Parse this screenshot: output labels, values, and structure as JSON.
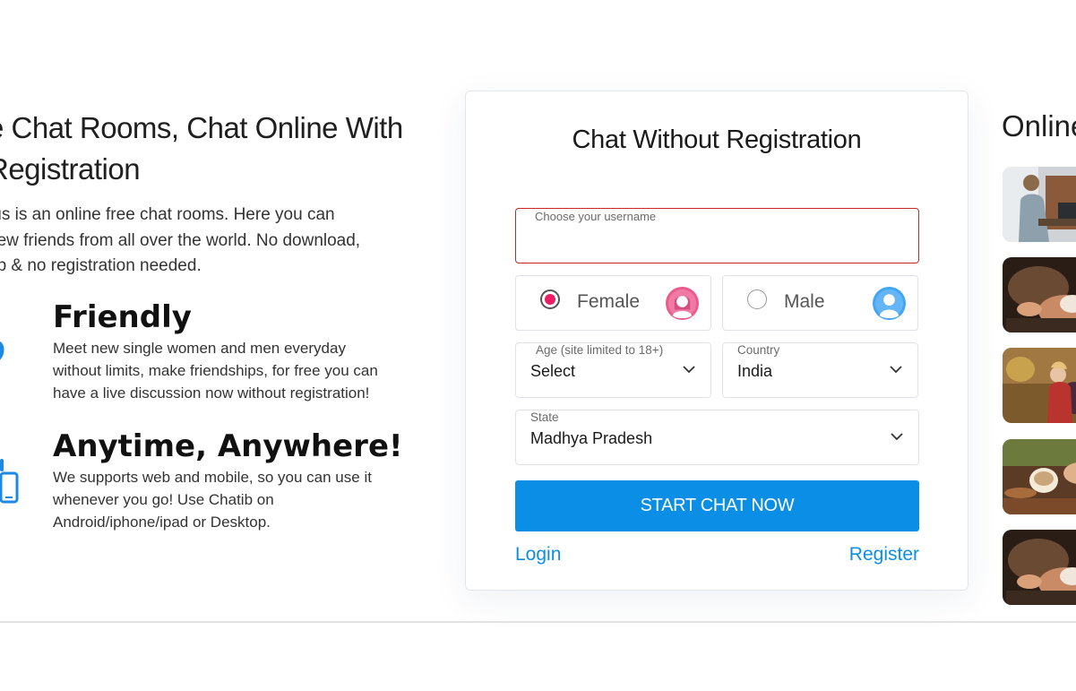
{
  "intro": {
    "title_line1": "e Chat Rooms, Chat Online With",
    "title_line2": "Registration",
    "desc_line1": ".us is an online free chat rooms. Here you can",
    "desc_line2": "new friends from all over the world. No download,",
    "desc_line3": "up & no registration needed."
  },
  "features": [
    {
      "title": "Friendly",
      "icon": "heart-icon",
      "desc_line1": "Meet new single women and men everyday",
      "desc_line2": "without limits, make friendships, for free you can",
      "desc_line3": "have a live discussion now without registration!"
    },
    {
      "title": "Anytime, Anywhere!",
      "icon": "phone-icon",
      "desc_line1": "We supports web and mobile, so you can use it",
      "desc_line2": "whenever you go! Use Chatib on",
      "desc_line3": "Android/iphone/ipad or Desktop."
    }
  ],
  "form": {
    "title": "Chat Without Registration",
    "username": {
      "label": "Choose your username",
      "value": ""
    },
    "gender": {
      "female_label": "Female",
      "male_label": "Male",
      "selected": "female"
    },
    "age": {
      "label": "Age (site limited to 18+)",
      "value": "Select"
    },
    "country": {
      "label": "Country",
      "value": "India"
    },
    "state": {
      "label": "State",
      "value": "Madhya Pradesh"
    },
    "start_button": "START CHAT NOW",
    "login_link": "Login",
    "register_link": "Register"
  },
  "online": {
    "title": "Online"
  },
  "colors": {
    "accent": "#0b8ee6",
    "female": "#e91e63",
    "male": "#42a5f5",
    "error_border": "#c62828",
    "icon": "#1e88e5"
  }
}
